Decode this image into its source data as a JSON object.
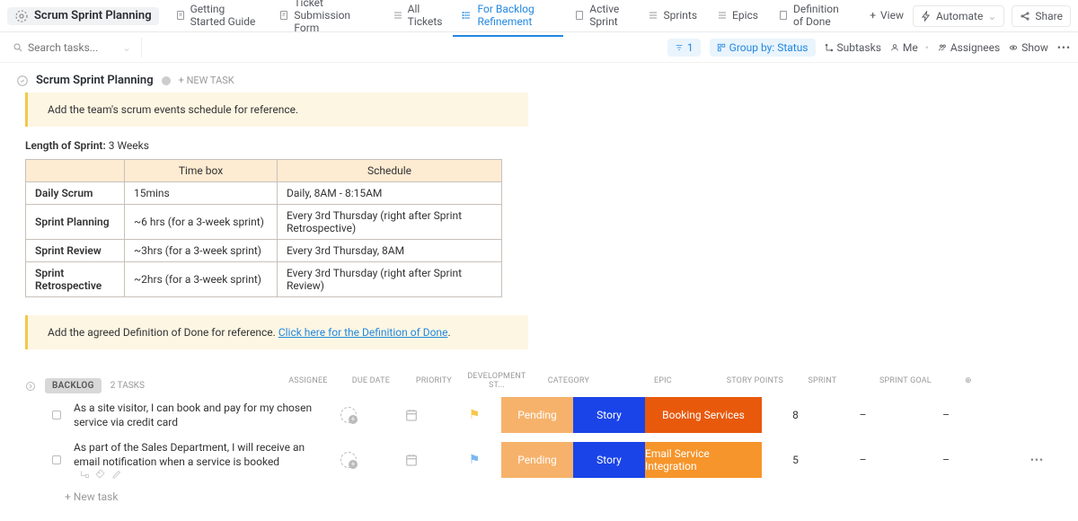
{
  "header": {
    "title": "Scrum Sprint Planning",
    "tabs": [
      {
        "label": "Getting Started Guide"
      },
      {
        "label": "Ticket Submission Form"
      },
      {
        "label": "All Tickets"
      },
      {
        "label": "For Backlog Refinement"
      },
      {
        "label": "Active Sprint"
      },
      {
        "label": "Sprints"
      },
      {
        "label": "Epics"
      },
      {
        "label": "Definition of Done"
      }
    ],
    "add_view": "View",
    "automate": "Automate",
    "share": "Share"
  },
  "filters": {
    "search_placeholder": "Search tasks...",
    "count": "1",
    "group": "Group by: Status",
    "subtasks": "Subtasks",
    "me": "Me",
    "assignees": "Assignees",
    "show": "Show"
  },
  "section": {
    "title": "Scrum Sprint Planning",
    "new_task": "+ NEW TASK",
    "callout1": "Add the team's scrum events schedule for reference.",
    "sprint_len_label": "Length of Sprint:",
    "sprint_len_val": "3 Weeks",
    "sched_headers": [
      "",
      "Time box",
      "Schedule"
    ],
    "sched_rows": [
      [
        "Daily Scrum",
        "15mins",
        "Daily, 8AM - 8:15AM"
      ],
      [
        "Sprint Planning",
        "~6 hrs (for a 3-week sprint)",
        "Every 3rd Thursday (right after Sprint Retrospective)"
      ],
      [
        "Sprint Review",
        "~3hrs (for a 3-week sprint)",
        "Every 3rd Thursday, 8AM"
      ],
      [
        "Sprint Retrospective",
        "~2hrs (for a 3-week sprint)",
        "Every 3rd Thursday (right after Sprint Review)"
      ]
    ],
    "callout2_pre": "Add the agreed Definition of Done for reference. ",
    "callout2_link": "Click here for the Definition of Done"
  },
  "backlog": {
    "label": "BACKLOG",
    "count": "2 TASKS",
    "columns": [
      "ASSIGNEE",
      "DUE DATE",
      "PRIORITY",
      "DEVELOPMENT ST...",
      "CATEGORY",
      "EPIC",
      "STORY POINTS",
      "SPRINT",
      "SPRINT GOAL"
    ],
    "tasks": [
      {
        "name": "As a site visitor, I can book and pay for my chosen service via credit card",
        "flag": "#f5c84c",
        "dev": "Pending",
        "cat": "Story",
        "epic": "Booking Services",
        "epic_cls": "epic-orange-dark",
        "sp": "8",
        "sprint": "–",
        "goal": "–"
      },
      {
        "name": "As part of the Sales Department, I will receive an email notification when a service is booked",
        "flag": "#7bb8f0",
        "dev": "Pending",
        "cat": "Story",
        "epic": "Email Service Integration",
        "epic_cls": "epic-orange",
        "sp": "5",
        "sprint": "–",
        "goal": "–"
      }
    ],
    "new_task": "+ New task"
  }
}
